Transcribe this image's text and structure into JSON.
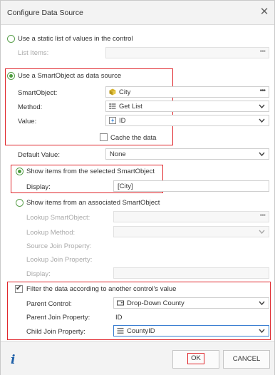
{
  "dialog": {
    "title": "Configure Data Source"
  },
  "static_list": {
    "label": "Use a static list of values in the control",
    "list_items_label": "List Items:"
  },
  "smartobject_source": {
    "label": "Use a SmartObject as data source",
    "smartobject_label": "SmartObject:",
    "smartobject_value": "City",
    "method_label": "Method:",
    "method_value": "Get List",
    "value_label": "Value:",
    "value_value": "ID",
    "cache_label": "Cache the data"
  },
  "default_value": {
    "label": "Default Value:",
    "value": "None"
  },
  "show_selected": {
    "label": "Show items from the selected SmartObject",
    "display_label": "Display:",
    "display_value": "[City]"
  },
  "show_associated": {
    "label": "Show items from an associated SmartObject",
    "lookup_smartobject_label": "Lookup SmartObject:",
    "lookup_method_label": "Lookup Method:",
    "source_join_label": "Source Join Property:",
    "lookup_join_label": "Lookup Join Property:",
    "display_label": "Display:"
  },
  "filter": {
    "label": "Filter the data according to another control's value",
    "parent_control_label": "Parent Control:",
    "parent_control_value": "Drop-Down County",
    "parent_join_label": "Parent Join Property:",
    "parent_join_value": "ID",
    "child_join_label": "Child Join Property:",
    "child_join_value": "CountyID"
  },
  "footer": {
    "info_glyph": "i",
    "ok_label": "OK",
    "cancel_label": "CANCEL"
  },
  "colors": {
    "highlight": "#e0282d",
    "radio": "#4a9b3c",
    "info": "#1d5fa8"
  }
}
